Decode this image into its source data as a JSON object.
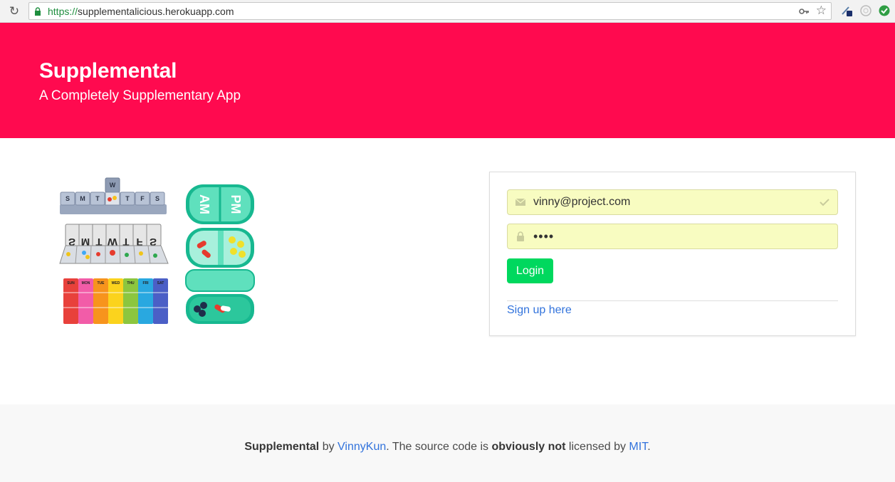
{
  "browser": {
    "url_scheme": "https://",
    "url_host": "supplementalicious.herokuapp.com"
  },
  "hero": {
    "title": "Supplemental",
    "subtitle": "A Completely Supplementary App"
  },
  "illustration": {
    "weekday_letters": [
      "S",
      "M",
      "T",
      "W",
      "T",
      "F",
      "S"
    ],
    "day_names": [
      "SUN",
      "MON",
      "TUE",
      "WED",
      "THU",
      "FRI",
      "SAT"
    ],
    "case_labels": [
      "AM",
      "PM"
    ]
  },
  "login": {
    "email_value": "vinny@project.com",
    "password_value": "••••",
    "login_label": "Login",
    "signup_label": "Sign up here"
  },
  "footer": {
    "app_name": "Supplemental",
    "by": " by ",
    "author": "VinnyKun",
    "middle": ". The source code is ",
    "emphasis": "obviously not",
    "after": " licensed by ",
    "license": "MIT",
    "end": "."
  },
  "colors": {
    "hero_bg": "#ff0a4f",
    "button_bg": "#00d85e",
    "link": "#3273dc",
    "autofill_bg": "#f8fcc1"
  }
}
